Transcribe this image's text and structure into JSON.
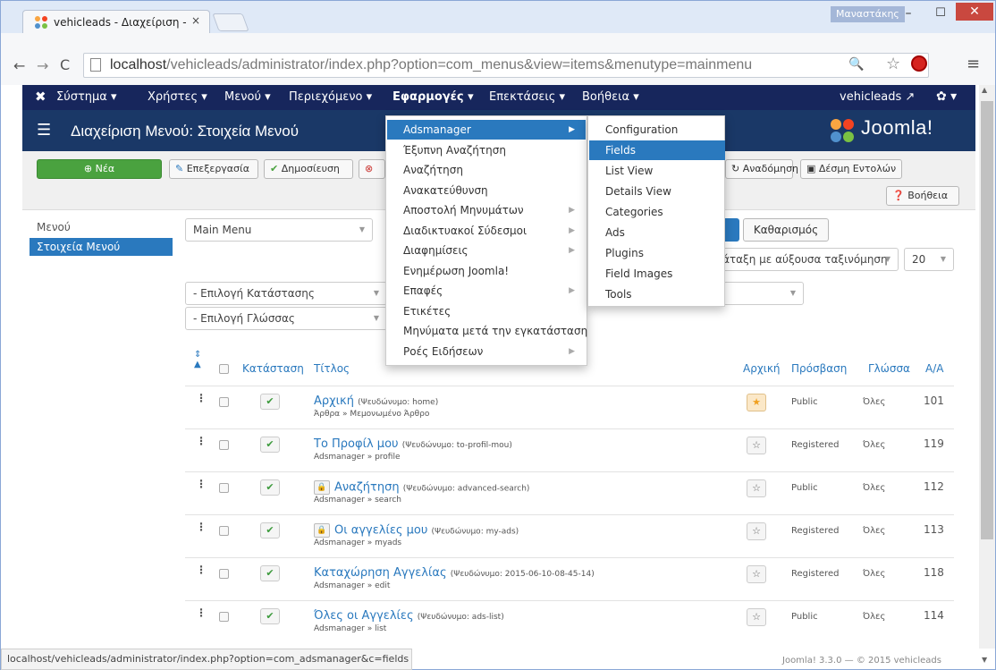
{
  "browser": {
    "tab_title": "vehicleads - Διαχείριση - ...",
    "tab_close": "×",
    "user_badge": "Μαναστάκης",
    "url_host": "localhost",
    "url_path": "/vehicleads/administrator/index.php?option=com_menus&view=items&menutype=mainmenu",
    "status_url": "localhost/vehicleads/administrator/index.php?option=com_adsmanager&c=fields"
  },
  "adminbar": {
    "items": [
      "Σύστημα ▾",
      "Χρήστες ▾",
      "Μενού ▾",
      "Περιεχόμενο ▾",
      "Εφαρμογές ▾",
      "Επεκτάσεις ▾",
      "Βοήθεια ▾"
    ],
    "site_name": "vehicleads ↗"
  },
  "header": {
    "title": "Διαχείριση Μενού: Στοιχεία Μενού",
    "logo_text": "Joomla!"
  },
  "actions": {
    "new": "Νέα",
    "edit": "Επεξεργασία",
    "publish": "Δημοσίευση",
    "rebuild": "Αναδόμηση",
    "batch": "Δέσμη Εντολών",
    "help": "Βοήθεια"
  },
  "sidebar": {
    "label": "Μενού",
    "active": "Στοιχεία Μενού"
  },
  "filters": {
    "menu": "Main Menu",
    "clear": "Καθαρισμός",
    "sort": "άταξη με αύξουσα ταξινόμηση",
    "limit": "20",
    "status": "- Επιλογή Κατάστασης",
    "language": "- Επιλογή Γλώσσας"
  },
  "table": {
    "headers": {
      "status": "Κατάσταση",
      "title": "Τίτλος",
      "home": "Αρχική",
      "access": "Πρόσβαση",
      "language": "Γλώσσα",
      "id": "A/A"
    },
    "rows": [
      {
        "title": "Αρχική",
        "alias": "(Ψευδώνυμο: home)",
        "sub": "Άρθρα » Μεμονωμένο Άρθρο",
        "access": "Public",
        "lang": "Όλες",
        "id": "101",
        "home": true,
        "locked": false
      },
      {
        "title": "Το Προφίλ μου",
        "alias": "(Ψευδώνυμο: to-profil-mou)",
        "sub": "Adsmanager » profile",
        "access": "Registered",
        "lang": "Όλες",
        "id": "119",
        "home": false,
        "locked": false
      },
      {
        "title": "Αναζήτηση",
        "alias": "(Ψευδώνυμο: advanced-search)",
        "sub": "Adsmanager » search",
        "access": "Public",
        "lang": "Όλες",
        "id": "112",
        "home": false,
        "locked": true
      },
      {
        "title": "Οι αγγελίες μου",
        "alias": "(Ψευδώνυμο: my-ads)",
        "sub": "Adsmanager » myads",
        "access": "Registered",
        "lang": "Όλες",
        "id": "113",
        "home": false,
        "locked": true
      },
      {
        "title": "Καταχώρηση Αγγελίας",
        "alias": "(Ψευδώνυμο: 2015-06-10-08-45-14)",
        "sub": "Adsmanager » edit",
        "access": "Registered",
        "lang": "Όλες",
        "id": "118",
        "home": false,
        "locked": false
      },
      {
        "title": "Όλες οι Αγγελίες",
        "alias": "(Ψευδώνυμο: ads-list)",
        "sub": "Adsmanager » list",
        "access": "Public",
        "lang": "Όλες",
        "id": "114",
        "home": false,
        "locked": false
      }
    ]
  },
  "menu_components": {
    "items": [
      "Adsmanager",
      "Έξυπνη Αναζήτηση",
      "Αναζήτηση",
      "Ανακατεύθυνση",
      "Αποστολή Μηνυμάτων",
      "Διαδικτυακοί Σύδεσμοι",
      "Διαφημίσεις",
      "Ενημέρωση Joomla!",
      "Επαφές",
      "Ετικέτες",
      "Μηνύματα μετά την εγκατάσταση",
      "Ροές Ειδήσεων"
    ]
  },
  "menu_adsmanager": {
    "items": [
      "Configuration",
      "Fields",
      "List View",
      "Details View",
      "Categories",
      "Ads",
      "Plugins",
      "Field Images",
      "Tools"
    ]
  },
  "footer": "Joomla! 3.3.0 — © 2015 vehicleads",
  "colors": {
    "accent": "#2a79be",
    "adminbar": "#17265c",
    "header": "#1a3867",
    "new_button": "#4aa23f"
  }
}
